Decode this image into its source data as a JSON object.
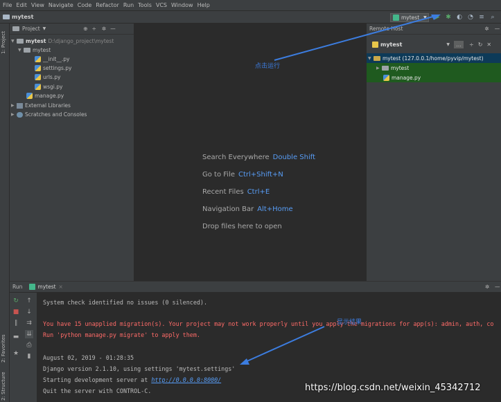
{
  "menu": [
    "File",
    "Edit",
    "View",
    "Navigate",
    "Code",
    "Refactor",
    "Run",
    "Tools",
    "VCS",
    "Window",
    "Help"
  ],
  "breadcrumb": "mytest",
  "run_config": "mytest",
  "left_tabs": {
    "project": "1: Project",
    "favorites": "2: Favorites",
    "structure": "2: Structure"
  },
  "project_panel": {
    "title": "Project",
    "root_name": "mytest",
    "root_path": "D:\\django_project\\mytest",
    "items": [
      "mytest",
      "__init__.py",
      "settings.py",
      "urls.py",
      "wsgi.py",
      "manage.py",
      "External Libraries",
      "Scratches and Consoles"
    ]
  },
  "editor_hints": [
    {
      "label": "Search Everywhere",
      "key": "Double Shift"
    },
    {
      "label": "Go to File",
      "key": "Ctrl+Shift+N"
    },
    {
      "label": "Recent Files",
      "key": "Ctrl+E"
    },
    {
      "label": "Navigation Bar",
      "key": "Alt+Home"
    },
    {
      "label": "Drop files here to open",
      "key": ""
    }
  ],
  "remote_panel": {
    "title": "Remote Host",
    "server": "mytest",
    "root": "mytest (127.0.0.1/home/pyvip/mytest)",
    "items": [
      "mytest",
      "manage.py"
    ]
  },
  "run_panel": {
    "label": "Run",
    "tab": "mytest",
    "lines": [
      {
        "text": "System check identified no issues (0 silenced).",
        "type": "normal"
      },
      {
        "text": "You have 15 unapplied migration(s). Your project may not work properly until you apply the migrations for app(s): admin, auth, co",
        "type": "red"
      },
      {
        "text": "Run 'python manage.py migrate' to apply them.",
        "type": "red"
      },
      {
        "text": "August 02, 2019 - 01:28:35",
        "type": "normal"
      },
      {
        "text": "Django version 2.1.10, using settings 'mytest.settings'",
        "type": "normal"
      },
      {
        "text": "Starting development server at ",
        "link": "http://0.0.0.0:8000/",
        "type": "normal"
      },
      {
        "text": "Quit the server with CONTROL-C.",
        "type": "normal"
      }
    ]
  },
  "annotations": {
    "run": "点击运行",
    "result": "显示结果"
  },
  "watermark": "https://blog.csdn.net/weixin_45342712",
  "colors": {
    "annotation": "#3c7de0",
    "link": "#589df6",
    "error": "#ff6b68"
  }
}
